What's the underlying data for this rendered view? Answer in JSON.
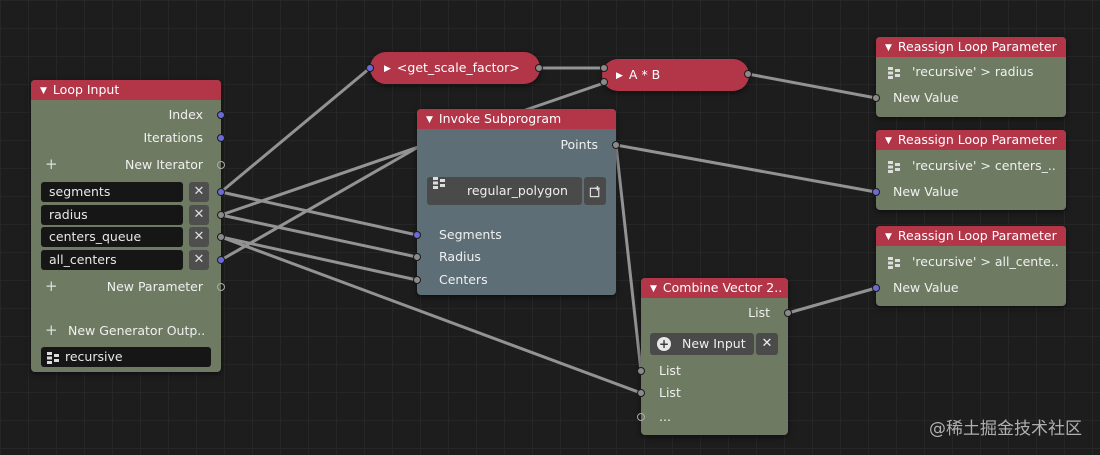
{
  "loop_input": {
    "title": "Loop Input",
    "outputs": [
      "Index",
      "Iterations"
    ],
    "new_iterator": "New Iterator",
    "params": [
      "segments",
      "radius",
      "centers_queue",
      "all_centers"
    ],
    "remove_symbol": "✕",
    "new_parameter": "New Parameter",
    "new_generator_output": "New Generator Outp..",
    "generator_field": "recursive"
  },
  "get_scale_factor": {
    "label": "<get_scale_factor>"
  },
  "multiply": {
    "label": "A * B"
  },
  "invoke_subprogram": {
    "title": "Invoke Subprogram",
    "output": "Points",
    "program": "regular_polygon",
    "inputs": [
      "Segments",
      "Radius",
      "Centers"
    ]
  },
  "combine_vector": {
    "title": "Combine Vector 2..",
    "output": "List",
    "new_input": "New Input",
    "inputs": [
      "List",
      "List",
      "..."
    ]
  },
  "reassign": [
    {
      "title": "Reassign Loop Parameter",
      "target": "'recursive' > radius",
      "input": "New Value"
    },
    {
      "title": "Reassign Loop Parameter",
      "target": "'recursive' > centers_..",
      "input": "New Value"
    },
    {
      "title": "Reassign Loop Parameter",
      "target": "'recursive' > all_cente..",
      "input": "New Value"
    }
  ],
  "watermark": "@稀土掘金技术社区",
  "colors": {
    "background": "#1d1d1d",
    "header_red": "#b23548",
    "node_green": "#6f7a62",
    "node_slate": "#5e6e77",
    "socket_blue": "#6b6bd8",
    "wire": "#9a9a9a"
  }
}
